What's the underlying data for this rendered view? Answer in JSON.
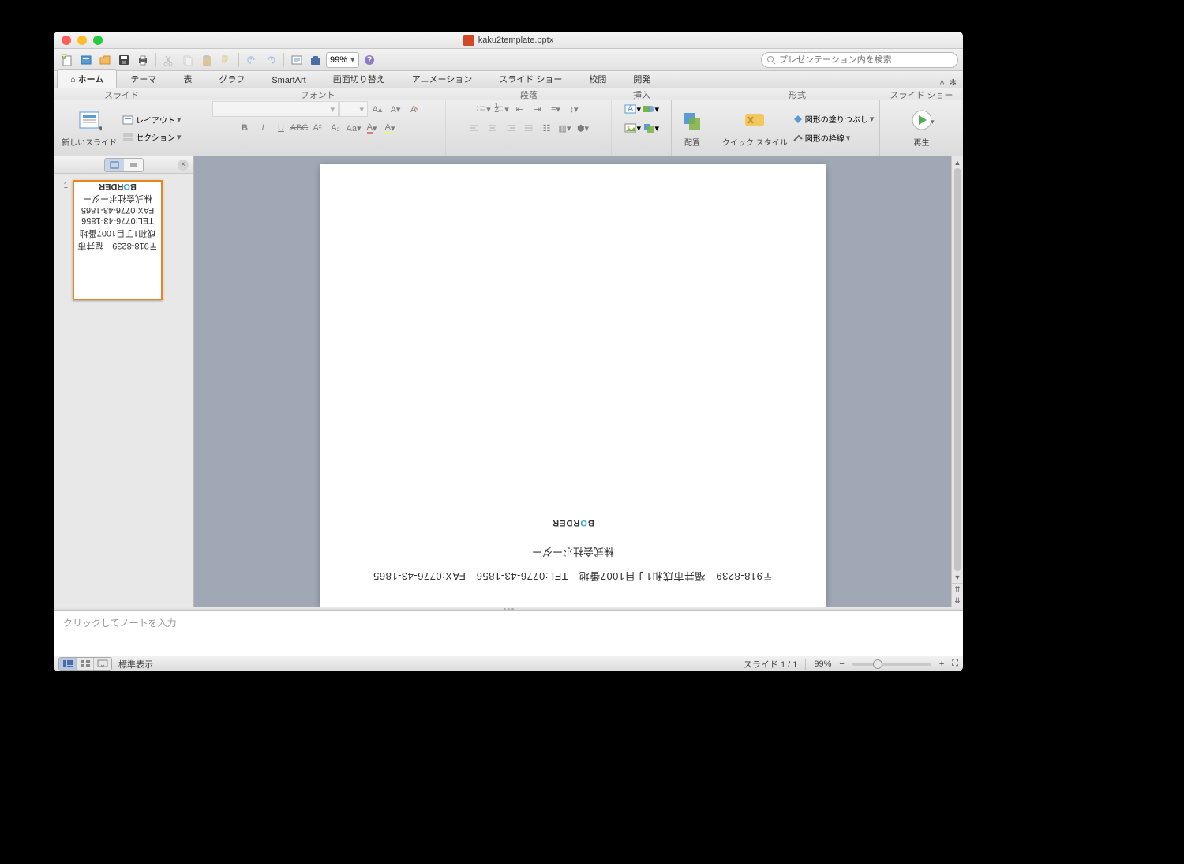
{
  "window": {
    "title": "kaku2template.pptx"
  },
  "quickbar": {
    "zoom": "99%",
    "search_placeholder": "プレゼンテーション内を検索"
  },
  "tabs": [
    "ホーム",
    "テーマ",
    "表",
    "グラフ",
    "SmartArt",
    "画面切り替え",
    "アニメーション",
    "スライド ショー",
    "校閲",
    "開発"
  ],
  "active_tab": 0,
  "ribbon": {
    "groups": {
      "slide": {
        "label": "スライド",
        "new_slide": "新しいスライド",
        "layout": "レイアウト",
        "section": "セクション"
      },
      "font": {
        "label": "フォント"
      },
      "paragraph": {
        "label": "段落"
      },
      "insert": {
        "label": "挿入"
      },
      "arrange": {
        "label": "配置",
        "btn": "配置"
      },
      "style": {
        "label": "形式",
        "quick": "クイック スタイル",
        "fill": "図形の塗りつぶし",
        "line": "図形の枠線"
      },
      "show": {
        "label": "スライド ショー",
        "play": "再生"
      }
    }
  },
  "thumbnails": {
    "items": [
      {
        "num": "1"
      }
    ]
  },
  "slide": {
    "address": "〒918-8239　福井市成和1丁目1007番地　TEL:0776-43-1856　FAX:0776-43-1865",
    "company": "株式会社ボーダー",
    "logo_parts": [
      "B",
      "O",
      "RDER"
    ]
  },
  "notes": {
    "placeholder": "クリックしてノートを入力"
  },
  "status": {
    "view": "標準表示",
    "slide_counter": "スライド 1 / 1",
    "zoom": "99%"
  }
}
